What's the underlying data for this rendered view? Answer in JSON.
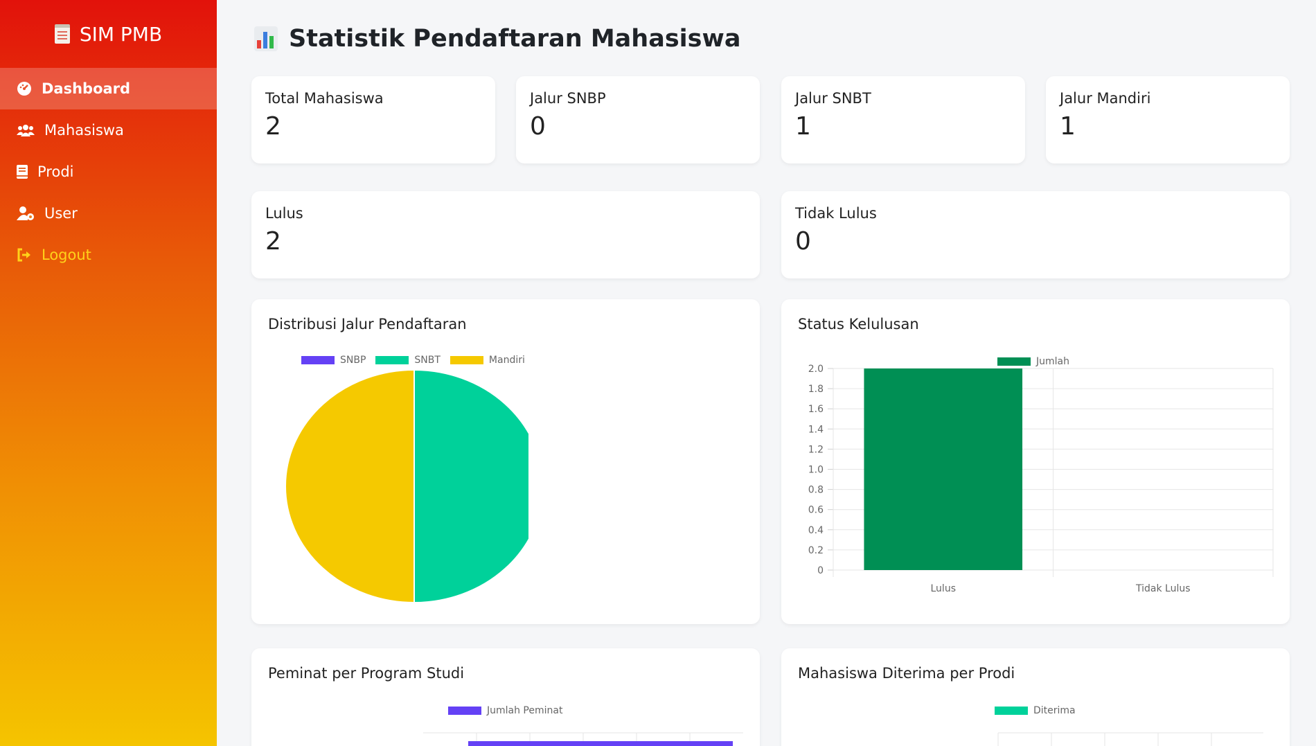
{
  "app": {
    "brand": "SIM PMB"
  },
  "sidebar": {
    "items": [
      {
        "label": "Dashboard",
        "icon": "gauge-icon",
        "active": true
      },
      {
        "label": "Mahasiswa",
        "icon": "users-icon"
      },
      {
        "label": "Prodi",
        "icon": "book-icon"
      },
      {
        "label": "User",
        "icon": "user-cog-icon"
      },
      {
        "label": "Logout",
        "icon": "logout-icon"
      }
    ]
  },
  "page": {
    "title": "Statistik Pendaftaran Mahasiswa"
  },
  "stats": {
    "total": {
      "label": "Total Mahasiswa",
      "value": "2"
    },
    "snbp": {
      "label": "Jalur SNBP",
      "value": "0"
    },
    "snbt": {
      "label": "Jalur SNBT",
      "value": "1"
    },
    "mandiri": {
      "label": "Jalur Mandiri",
      "value": "1"
    },
    "lulus": {
      "label": "Lulus",
      "value": "2"
    },
    "tidak_lulus": {
      "label": "Tidak Lulus",
      "value": "0"
    }
  },
  "colors": {
    "snbp": "#6441f5",
    "snbt": "#00d19a",
    "mandiri": "#f5c900",
    "jumlah": "#008f54"
  },
  "chart_data": [
    {
      "type": "pie",
      "title": "Distribusi Jalur Pendaftaran",
      "categories": [
        "SNBP",
        "SNBT",
        "Mandiri"
      ],
      "values": [
        0,
        1,
        1
      ],
      "legend": "top"
    },
    {
      "type": "bar",
      "title": "Status Kelulusan",
      "categories": [
        "Lulus",
        "Tidak Lulus"
      ],
      "series": [
        {
          "name": "Jumlah",
          "values": [
            2,
            0
          ]
        }
      ],
      "ylim": [
        0,
        2.0
      ],
      "yticks": [
        "2.0",
        "1.8",
        "1.6",
        "1.4",
        "1.2",
        "1.0",
        "0.8",
        "0.6",
        "0.4",
        "0.2",
        "0"
      ],
      "grid": true,
      "legend": "top"
    },
    {
      "type": "bar",
      "title": "Peminat per Program Studi",
      "series": [
        {
          "name": "Jumlah Peminat"
        }
      ],
      "legend": "top"
    },
    {
      "type": "bar",
      "title": "Mahasiswa Diterima per Prodi",
      "series": [
        {
          "name": "Diterima"
        }
      ],
      "legend": "top"
    }
  ]
}
